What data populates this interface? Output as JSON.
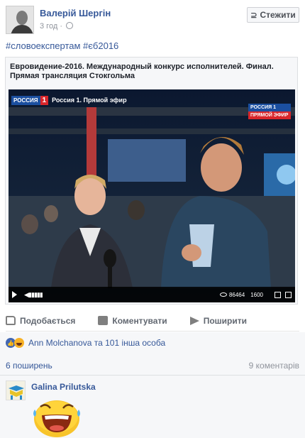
{
  "post": {
    "author": "Валерій Шергін",
    "time": "3 год",
    "time_separator": "·",
    "follow_label": "Стежити",
    "follow_icon": "rss-icon",
    "hashtags": "#словоекспертам #єб2016"
  },
  "shared": {
    "title": "Евровидение-2016. Международный конкурс исполнителей. Финал. Прямая трансляция Стокгольма",
    "video": {
      "channel_logo_text": "РОССИЯ",
      "channel_logo_number": "1",
      "channel_caption": "Россия 1. Прямой эфир",
      "live_badge_top": "РОССИЯ 1",
      "live_badge_bottom": "ПРЯМОЙ ЭФИР",
      "viewers": "86464",
      "quality": "1600"
    }
  },
  "actions": {
    "like": "Подобається",
    "comment": "Коментувати",
    "share": "Поширити"
  },
  "reactions": {
    "summary": "Ann Molchanova та 101 інша особа"
  },
  "stats": {
    "shares": "6 поширень",
    "comments": "9 коментарів"
  },
  "comment": {
    "author": "Galina Prilutska"
  },
  "colors": {
    "link": "#365899",
    "muted": "#90949c",
    "like_blue": "#4267b2",
    "haha_yellow": "#f7b125"
  }
}
